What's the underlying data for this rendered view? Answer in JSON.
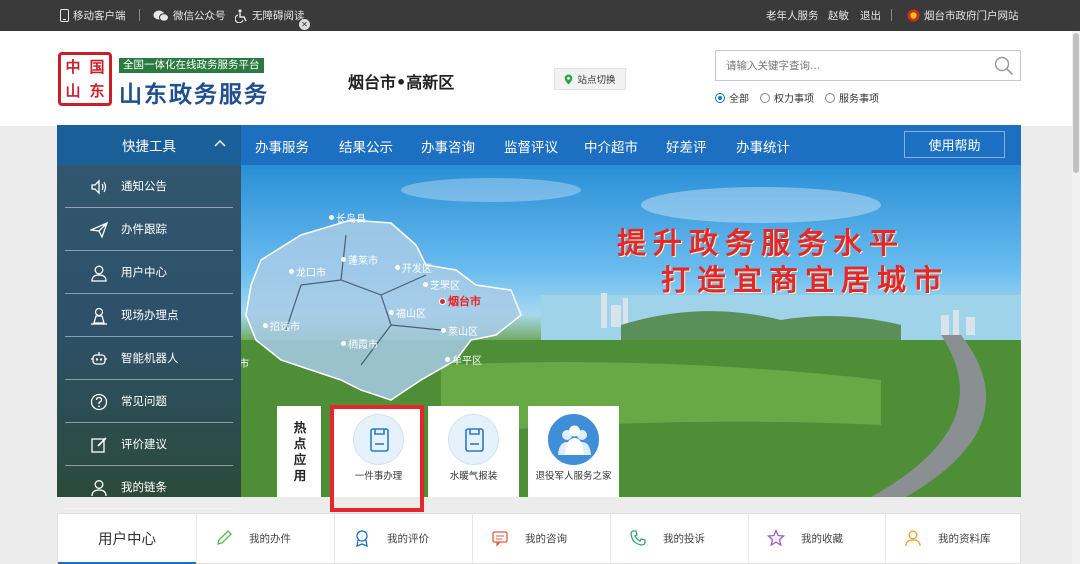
{
  "topbar": {
    "mobile_client": "移动客户端",
    "wechat": "微信公众号",
    "accessible": "无障碍阅读",
    "elderly": "老年人服务",
    "user": "赵敏",
    "logout": "退出",
    "portal": "烟台市政府门户网站"
  },
  "header": {
    "seal_chars": [
      "中",
      "国",
      "山",
      "东"
    ],
    "platform_subtitle": "全国一体化在线政务服务平台",
    "title": "山东政务服务",
    "city": "烟台市•高新区",
    "station_switch": "站点切换",
    "search_placeholder": "请输入关键字查询...",
    "radios": [
      {
        "label": "全部",
        "checked": true
      },
      {
        "label": "权力事项",
        "checked": false
      },
      {
        "label": "服务事项",
        "checked": false
      }
    ]
  },
  "nav": {
    "quick_tools": "快捷工具",
    "items": [
      "办事服务",
      "结果公示",
      "办事咨询",
      "监督评议",
      "中介超市",
      "好差评",
      "办事统计"
    ],
    "help": "使用帮助"
  },
  "sidebar": {
    "items": [
      {
        "label": "通知公告",
        "icon": "speaker-icon"
      },
      {
        "label": "办件跟踪",
        "icon": "paper-plane-icon"
      },
      {
        "label": "用户中心",
        "icon": "user-icon"
      },
      {
        "label": "现场办理点",
        "icon": "location-person-icon"
      },
      {
        "label": "智能机器人",
        "icon": "robot-icon"
      },
      {
        "label": "常见问题",
        "icon": "question-icon"
      },
      {
        "label": "评价建议",
        "icon": "edit-icon"
      },
      {
        "label": "我的链条",
        "icon": "person-icon"
      }
    ]
  },
  "banner": {
    "slogan_line1": "提升政务服务水平",
    "slogan_line2": "打造宜商宜居城市",
    "map_labels": {
      "changdao": "长岛县",
      "penglai": "蓬莱市",
      "longkou": "龙口市",
      "kaifaqu": "开发区",
      "zhifu": "芝罘区",
      "yantai": "烟台市",
      "fushan": "福山区",
      "laishan": "莱山区",
      "zhaoyuan": "招远市",
      "qixia": "栖霞市",
      "muping": "牟平区",
      "laizhou": "莱州市"
    }
  },
  "hot_apps": {
    "title": "热点应用",
    "items": [
      {
        "label": "一件事办理",
        "icon": "document-icon"
      },
      {
        "label": "水暖气报装",
        "icon": "document-icon"
      },
      {
        "label": "退役军人服务之家",
        "icon": "soldiers-icon"
      }
    ]
  },
  "user_center": {
    "title": "用户中心",
    "items": [
      {
        "label": "我的办件",
        "icon": "pencil-icon",
        "color": "#5cb85c"
      },
      {
        "label": "我的评价",
        "icon": "badge-icon",
        "color": "#1d6fc2"
      },
      {
        "label": "我的咨询",
        "icon": "chat-icon",
        "color": "#e05a3a"
      },
      {
        "label": "我的投诉",
        "icon": "phone-icon",
        "color": "#3aa57a"
      },
      {
        "label": "我的收藏",
        "icon": "star-icon",
        "color": "#9b59b6"
      },
      {
        "label": "我的资料库",
        "icon": "profile-icon",
        "color": "#f0a030"
      }
    ]
  },
  "colors": {
    "nav_blue": "#1d6fc2",
    "quick_tools_bg": "#1a5f98",
    "slogan_red": "#e8262a",
    "highlight_red": "#e5262c",
    "brand_blue": "#1f4f8e",
    "platform_green": "#2b7a3f"
  }
}
